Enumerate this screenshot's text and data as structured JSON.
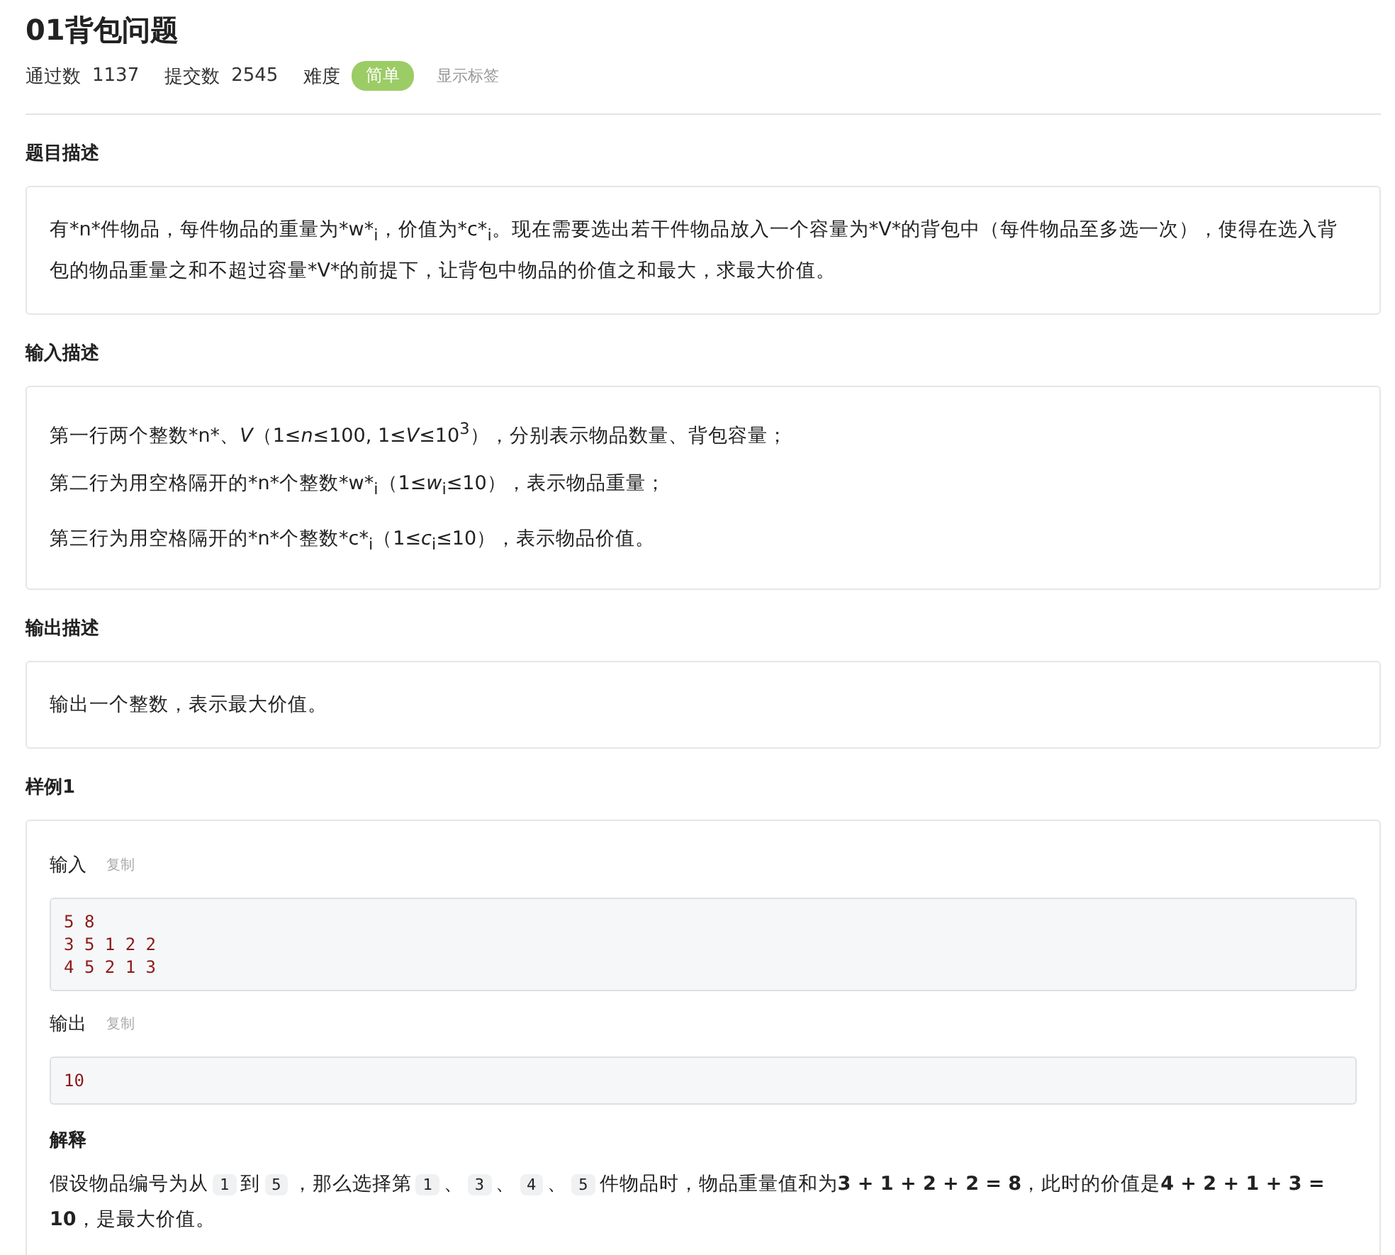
{
  "title": "01背包问题",
  "stats": [
    {
      "label": "通过数",
      "value": "1137"
    },
    {
      "label": "提交数",
      "value": "2545"
    }
  ],
  "difficulty": {
    "label": "难度",
    "value": "简单",
    "color": "#9ccc65"
  },
  "show_tags": "显示标签",
  "sections": [
    {
      "heading": "题目描述",
      "paragraphs": [
        "有*n*件物品，每件物品的重量为*w*$_{i}$，价值为*c*$_{i}$。现在需要选出若干件物品放入一个容量为*V*的背包中（每件物品至多选一次），使得在选入背包的物品重量之和不超过容量*V*的前提下，让背包中物品的价值之和最大，求最大价值。"
      ]
    },
    {
      "heading": "输入描述",
      "paragraphs": [
        "第一行两个整数*n*、*V*（1≤*n*≤100, 1≤*V*≤10$^{3}$），分别表示物品数量、背包容量；",
        "第二行为用空格隔开的*n*个整数*w*$_{i}$（1≤*w*$_{i}$≤10），表示物品重量；",
        "第三行为用空格隔开的*n*个整数*c*$_{i}$（1≤*c*$_{i}$≤10），表示物品价值。"
      ]
    },
    {
      "heading": "输出描述",
      "paragraphs": [
        "输出一个整数，表示最大价值。"
      ]
    }
  ],
  "sample": {
    "heading": "样例1",
    "blocks": [
      {
        "label": "输入",
        "copy": "复制",
        "lines": [
          "5 8",
          "3 5 1 2 2",
          "4 5 2 1 3"
        ]
      },
      {
        "label": "输出",
        "copy": "复制",
        "lines": [
          "10"
        ]
      }
    ],
    "explain_heading": "解释",
    "explanation": [
      {
        "kind": "text",
        "text": "假设物品编号为从"
      },
      {
        "kind": "code",
        "text": "1"
      },
      {
        "kind": "text",
        "text": "到"
      },
      {
        "kind": "code",
        "text": "5"
      },
      {
        "kind": "text",
        "text": "，那么选择第"
      },
      {
        "kind": "code",
        "text": "1"
      },
      {
        "kind": "text",
        "text": "、"
      },
      {
        "kind": "code",
        "text": "3"
      },
      {
        "kind": "text",
        "text": "、"
      },
      {
        "kind": "code",
        "text": "4"
      },
      {
        "kind": "text",
        "text": "、"
      },
      {
        "kind": "code",
        "text": "5"
      },
      {
        "kind": "text",
        "text": "件物品时，物品重量值和为**3 + 1 + 2 + 2 = 8**，此时的价值是**4 + 2 + 1 + 3 = 10**，是最大价值。"
      }
    ]
  }
}
